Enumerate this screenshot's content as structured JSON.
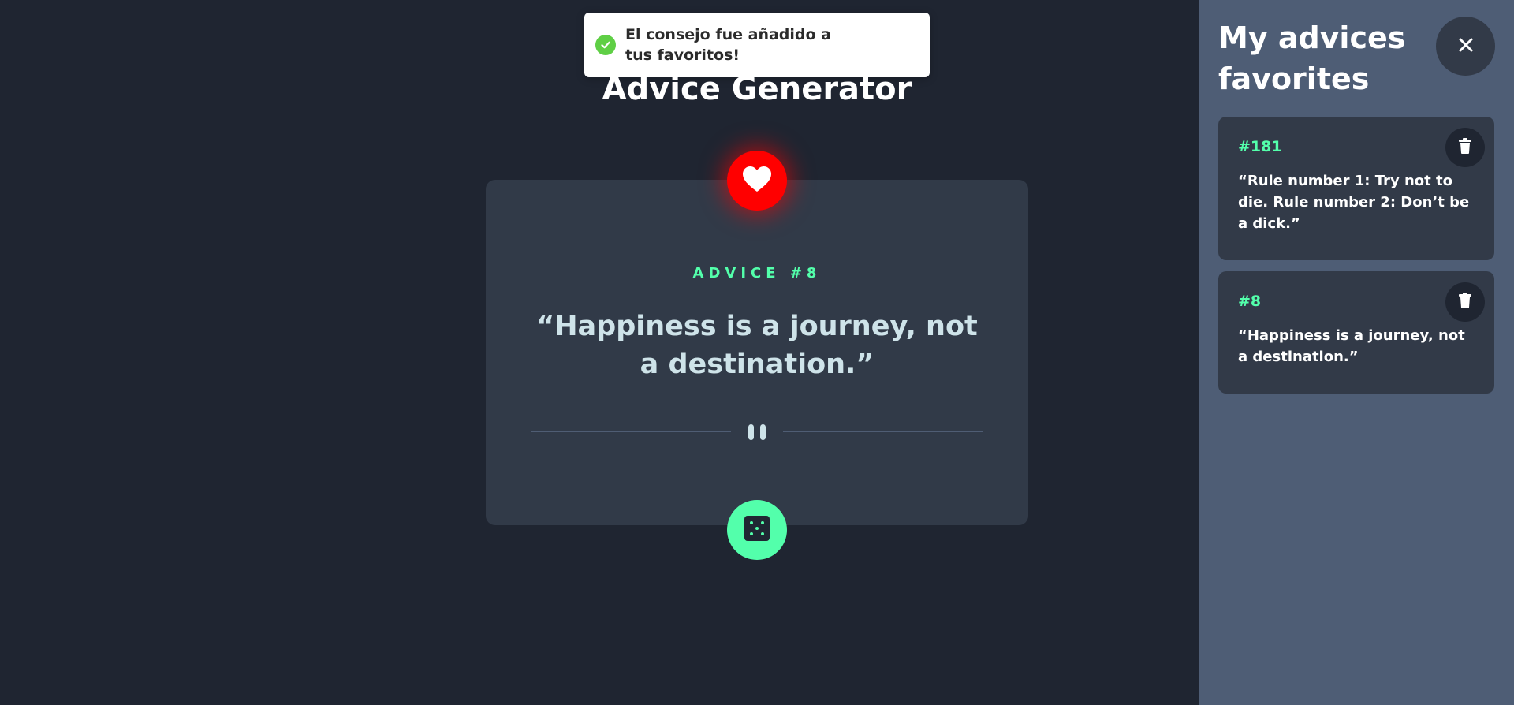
{
  "toast": {
    "message": "El consejo fue añadido a tus favoritos!",
    "icon": "check-circle-icon",
    "accent": "#5fcf45"
  },
  "app": {
    "title": "Advice Generator"
  },
  "advice": {
    "id_label": "ADVICE #8",
    "quote": "“Happiness is a journey, not a destination.”"
  },
  "buttons": {
    "favorite_icon": "heart-icon",
    "favorite_color": "#ff0000",
    "generate_icon": "dice-icon",
    "generate_color": "#53ffab"
  },
  "sidebar": {
    "title": "My advices favorites",
    "close_icon": "close-icon",
    "favorites": [
      {
        "id": "#181",
        "text": "“Rule number 1: Try not to die. Rule number 2: Don’t be a dick.”"
      },
      {
        "id": "#8",
        "text": "“Happiness is a journey, not a destination.”"
      }
    ]
  },
  "colors": {
    "background": "#1f2531",
    "card": "#313a48",
    "sidebar": "#4e5d75",
    "accent_green": "#53ffab",
    "text": "#cee3e9"
  }
}
